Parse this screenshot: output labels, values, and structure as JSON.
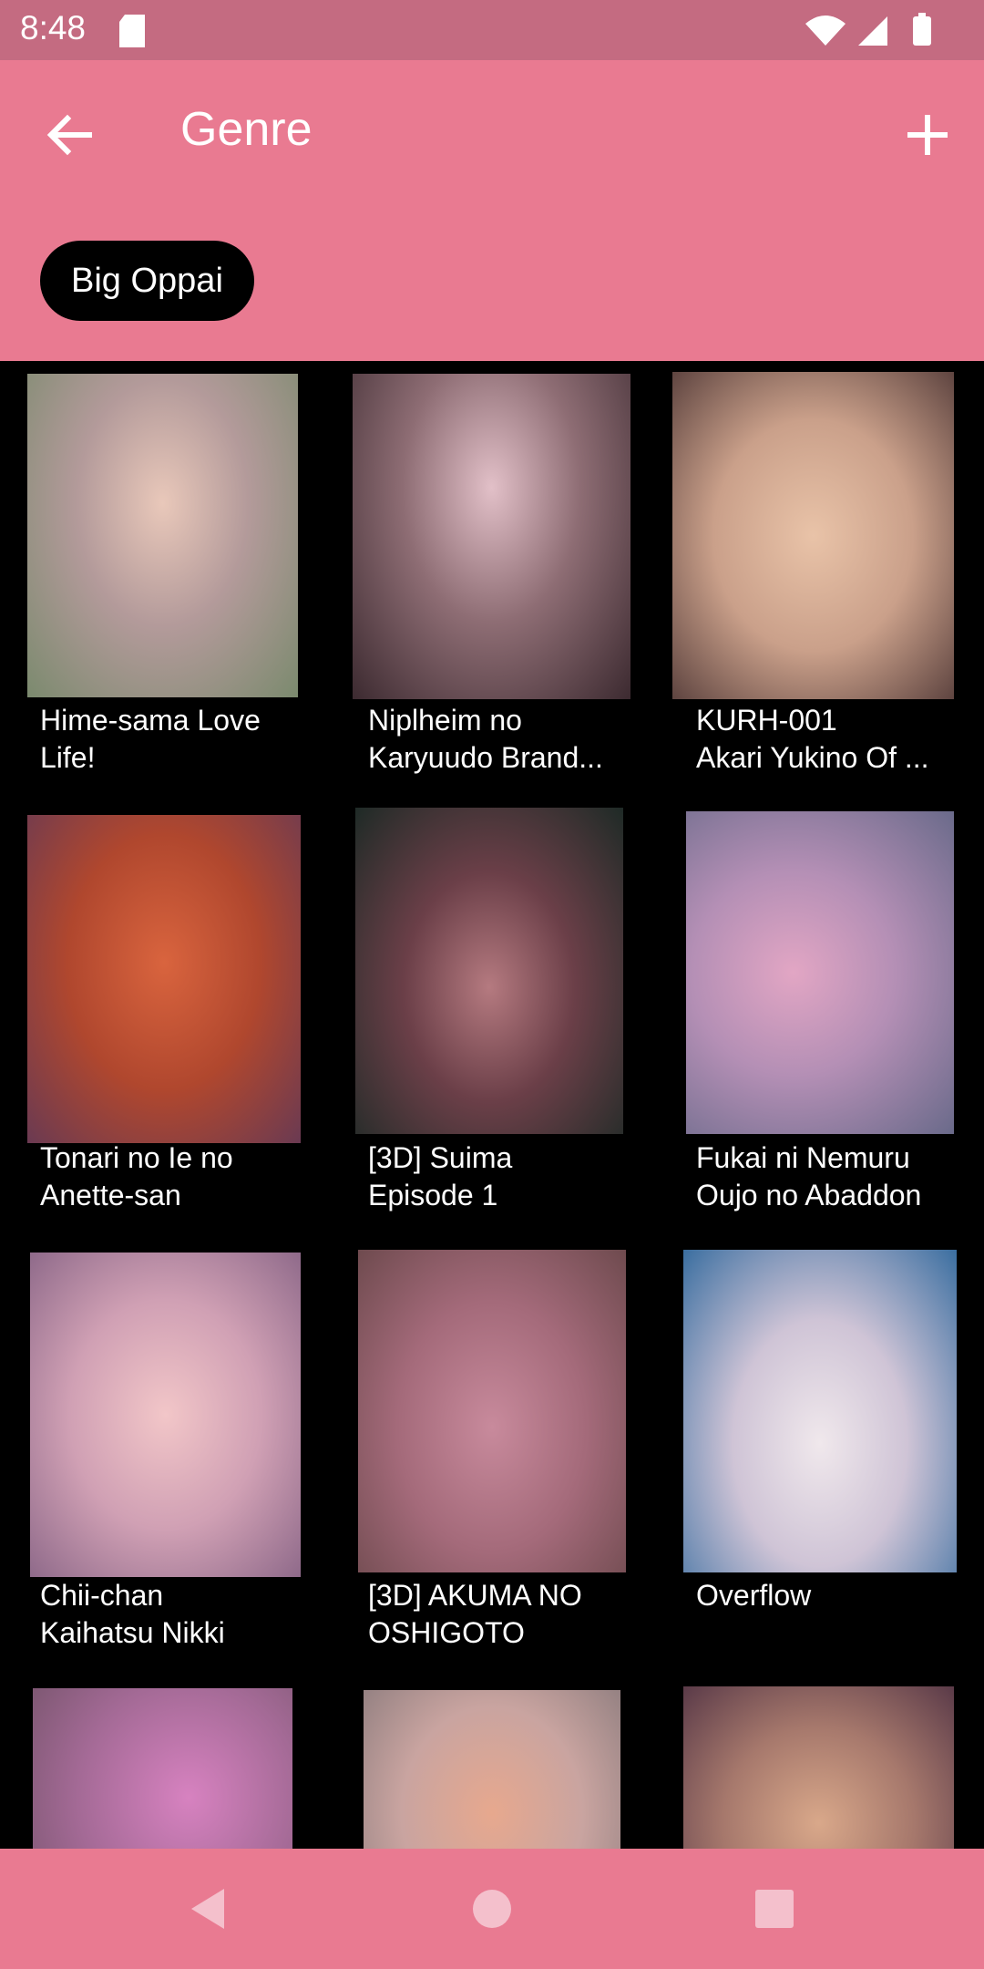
{
  "status": {
    "time": "8:48"
  },
  "header": {
    "title": "Genre",
    "back_icon": "arrow-back-icon",
    "add_icon": "plus-icon"
  },
  "filter_chip": {
    "label": "Big Oppai"
  },
  "items": [
    {
      "line1": "Hime-sama Love",
      "line2": "Life!"
    },
    {
      "line1": "Niplheim no",
      "line2": "Karyuudo Brand..."
    },
    {
      "line1": "KURH-001",
      "line2": "Akari Yukino Of ..."
    },
    {
      "line1": "Tonari no Ie no",
      "line2": "Anette-san"
    },
    {
      "line1": "[3D] Suima",
      "line2": "Episode 1"
    },
    {
      "line1": "Fukai ni Nemuru",
      "line2": "Oujo no Abaddon"
    },
    {
      "line1": "Chii-chan",
      "line2": "Kaihatsu Nikki"
    },
    {
      "line1": "[3D] AKUMA NO",
      "line2": "OSHIGOTO"
    },
    {
      "line1": "Overflow",
      "line2": ""
    }
  ],
  "colors": {
    "app_bar": "#e97a91",
    "status_bar": "#c46b81",
    "background": "#000000"
  }
}
